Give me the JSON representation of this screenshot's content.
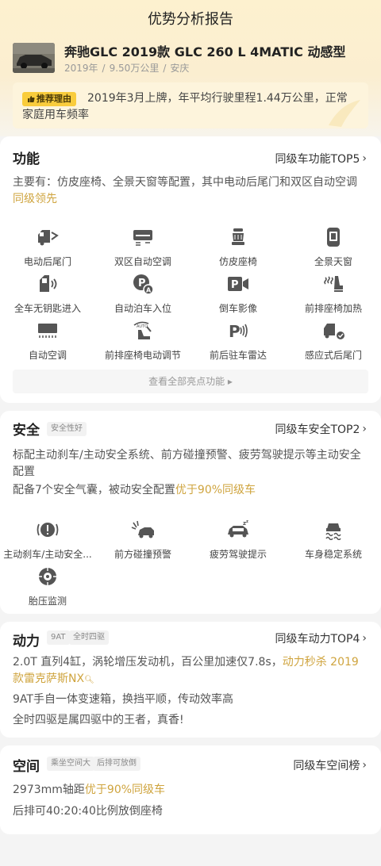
{
  "page_title": "优势分析报告",
  "car": {
    "name": "奔驰GLC 2019款 GLC 260 L 4MATIC 动感型",
    "year": "2019年",
    "mileage": "9.50万公里",
    "city": "安庆"
  },
  "reason": {
    "tag": "推荐理由",
    "text": "2019年3月上牌，年平均行驶里程1.44万公里，正常家庭用车频率"
  },
  "features": {
    "title": "功能",
    "link": "同级车功能TOP5",
    "summary_plain": "主要有：仿皮座椅、全景天窗等配置，其中电动后尾门和双区自动空调",
    "summary_hl": "同级领先",
    "items": [
      {
        "label": "电动后尾门",
        "icon": "power-tailgate-icon"
      },
      {
        "label": "双区自动空调",
        "icon": "dual-zone-ac-icon"
      },
      {
        "label": "仿皮座椅",
        "icon": "leather-seat-icon"
      },
      {
        "label": "全景天窗",
        "icon": "panoramic-sunroof-icon"
      },
      {
        "label": "全车无钥匙进入",
        "icon": "keyless-entry-icon"
      },
      {
        "label": "自动泊车入位",
        "icon": "auto-parking-icon"
      },
      {
        "label": "倒车影像",
        "icon": "reverse-camera-icon"
      },
      {
        "label": "前排座椅加热",
        "icon": "seat-heating-icon"
      },
      {
        "label": "自动空调",
        "icon": "auto-ac-icon"
      },
      {
        "label": "前排座椅电动调节",
        "icon": "power-seat-icon"
      },
      {
        "label": "前后驻车雷达",
        "icon": "parking-radar-icon"
      },
      {
        "label": "感应式后尾门",
        "icon": "sensor-tailgate-icon"
      }
    ],
    "more_label": "查看全部亮点功能 ▸"
  },
  "safety": {
    "title": "安全",
    "tag": "安全性好",
    "link": "同级车安全TOP2",
    "line1": "标配主动刹车/主动安全系统、前方碰撞预警、疲劳驾驶提示等主动安全配置",
    "line2_plain": "配备7个安全气囊，被动安全配置",
    "line2_hl": "优于90%同级车",
    "items": [
      {
        "label": "主动刹车/主动安全...",
        "icon": "active-brake-icon"
      },
      {
        "label": "前方碰撞预警",
        "icon": "collision-warning-icon"
      },
      {
        "label": "疲劳驾驶提示",
        "icon": "fatigue-alert-icon"
      },
      {
        "label": "车身稳定系统",
        "icon": "stability-control-icon"
      },
      {
        "label": "胎压监测",
        "icon": "tire-pressure-icon"
      }
    ]
  },
  "power": {
    "title": "动力",
    "tags": [
      "9AT",
      "全时四驱"
    ],
    "link": "同级车动力TOP4",
    "line1_plain": "2.0T 直列4缸，涡轮增压发动机，百公里加速仅7.8s，",
    "line1_hl": "动力秒杀 2019款雷克萨斯NX",
    "line2": "9AT手自一体变速箱，换挡平顺，传动效率高",
    "line3": "全时四驱是属四驱中的王者，真香!"
  },
  "space": {
    "title": "空间",
    "tags": [
      "乘坐空间大",
      "后排可放倒"
    ],
    "link": "同级车空间榜",
    "line1_plain": "2973mm轴距",
    "line1_hl": "优于90%同级车",
    "line2": "后排可40:20:40比例放倒座椅"
  },
  "colors": {
    "accent": "#cfa43e",
    "tag_yellow": "#f9cc3c",
    "header_bg": "#fdf1cf"
  }
}
